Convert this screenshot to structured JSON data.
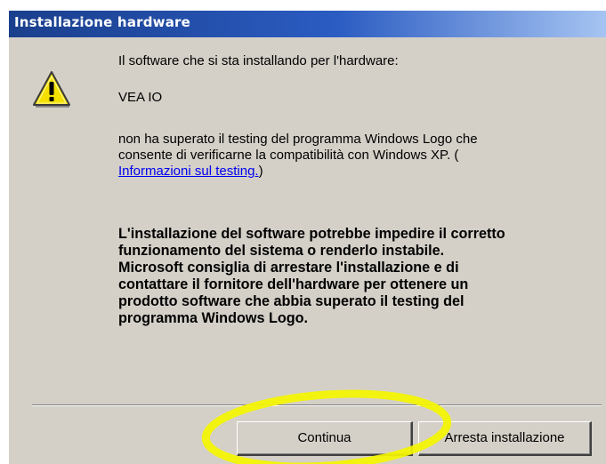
{
  "dialog": {
    "title": "Installazione hardware",
    "intro": "Il software che si sta installando per l'hardware:",
    "device_name": "VEA IO",
    "message_lines": [
      "non ha superato il testing del programma Windows Logo che",
      "consente di verificarne la compatibilità con Windows XP. ("
    ],
    "link_text": "Informazioni sul testing.",
    "link_suffix": ")",
    "warning_lines": [
      "L'installazione del software potrebbe impedire il corretto",
      "funzionamento del sistema o renderlo instabile.",
      "Microsoft consiglia di arrestare l'installazione e di",
      "contattare il fornitore dell'hardware per ottenere un",
      "prodotto software che abbia superato il testing del",
      "programma Windows Logo."
    ]
  },
  "buttons": {
    "continue_label": "Continua",
    "stop_label": "Arresta installazione"
  },
  "icons": {
    "warning": "warning-triangle-icon"
  },
  "colors": {
    "title_bar": "#1a3f8c",
    "window_bg": "#d4d0c8",
    "link": "#0000ee",
    "highlight": "#f5f500"
  }
}
